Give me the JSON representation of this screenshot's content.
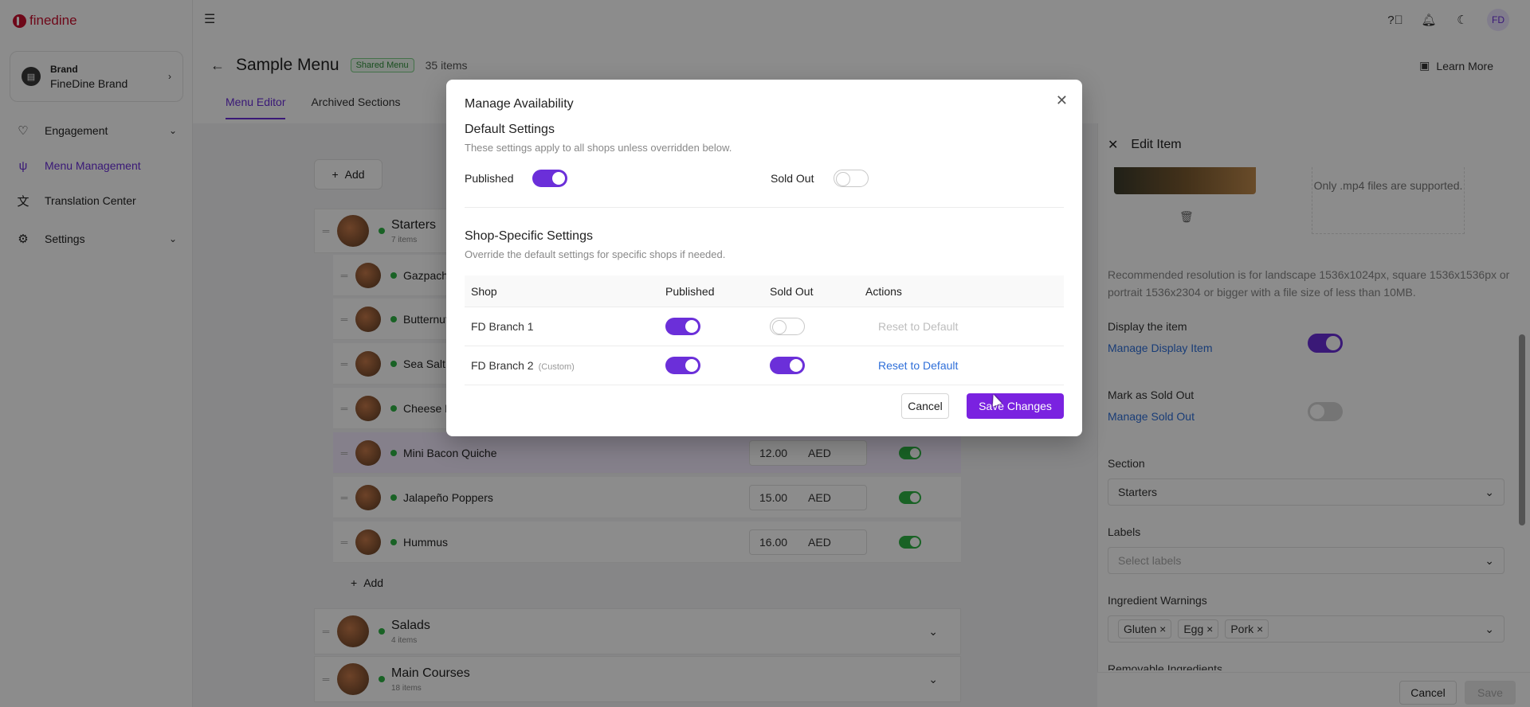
{
  "app": {
    "logo_text": "finedine"
  },
  "sidebar": {
    "brand_label": "Brand",
    "brand_name": "FineDine Brand",
    "items": [
      {
        "label": "Engagement",
        "icon": "heart-icon",
        "has_chevron": true
      },
      {
        "label": "Menu Management",
        "icon": "utensils-icon",
        "active": true
      },
      {
        "label": "Translation Center",
        "icon": "translate-icon"
      },
      {
        "label": "Settings",
        "icon": "gear-icon",
        "has_chevron": true
      }
    ]
  },
  "topbar": {
    "avatar": "FD"
  },
  "page": {
    "title": "Sample Menu",
    "badge": "Shared Menu",
    "item_count": "35 items",
    "learn_more": "Learn More",
    "tabs": [
      "Menu Editor",
      "Archived Sections"
    ]
  },
  "menu": {
    "add_label": "Add",
    "sections": [
      {
        "name": "Starters",
        "sub": "7 items"
      },
      {
        "name": "Salads",
        "sub": "4 items"
      },
      {
        "name": "Main Courses",
        "sub": "18 items"
      }
    ],
    "items": [
      {
        "name": "Gazpacho"
      },
      {
        "name": "Butternut"
      },
      {
        "name": "Sea Salt"
      },
      {
        "name": "Cheese F"
      },
      {
        "name": "Mini Bacon Quiche",
        "price": "12.00",
        "currency": "AED"
      },
      {
        "name": "Jalapeño Poppers",
        "price": "15.00",
        "currency": "AED"
      },
      {
        "name": "Hummus",
        "price": "16.00",
        "currency": "AED"
      }
    ],
    "add_item_label": "Add"
  },
  "edit_panel": {
    "title": "Edit Item",
    "video_note": "Only .mp4 files are supported.",
    "recommended": "Recommended resolution is for landscape 1536x1024px, square 1536x1536px or portrait 1536x2304 or bigger with a file size of less than 10MB.",
    "display_label": "Display the item",
    "display_link": "Manage Display Item",
    "sold_label": "Mark as Sold Out",
    "sold_link": "Manage Sold Out",
    "section_label": "Section",
    "section_value": "Starters",
    "labels_label": "Labels",
    "labels_placeholder": "Select labels",
    "warnings_label": "Ingredient Warnings",
    "warnings": [
      "Gluten",
      "Egg",
      "Pork"
    ],
    "removable_label": "Removable Ingredients",
    "cancel": "Cancel",
    "save": "Save"
  },
  "modal": {
    "title": "Manage Availability",
    "default_title": "Default Settings",
    "default_desc": "These settings apply to all shops unless overridden below.",
    "published_label": "Published",
    "sold_out_label": "Sold Out",
    "shop_title": "Shop-Specific Settings",
    "shop_desc": "Override the default settings for specific shops if needed.",
    "columns": {
      "shop": "Shop",
      "published": "Published",
      "sold_out": "Sold Out",
      "actions": "Actions"
    },
    "shops": [
      {
        "name": "FD Branch 1",
        "custom": "",
        "reset": "Reset to Default"
      },
      {
        "name": "FD Branch 2",
        "custom": "(Custom)",
        "reset": "Reset to Default"
      }
    ],
    "cancel": "Cancel",
    "save": "Save Changes"
  }
}
